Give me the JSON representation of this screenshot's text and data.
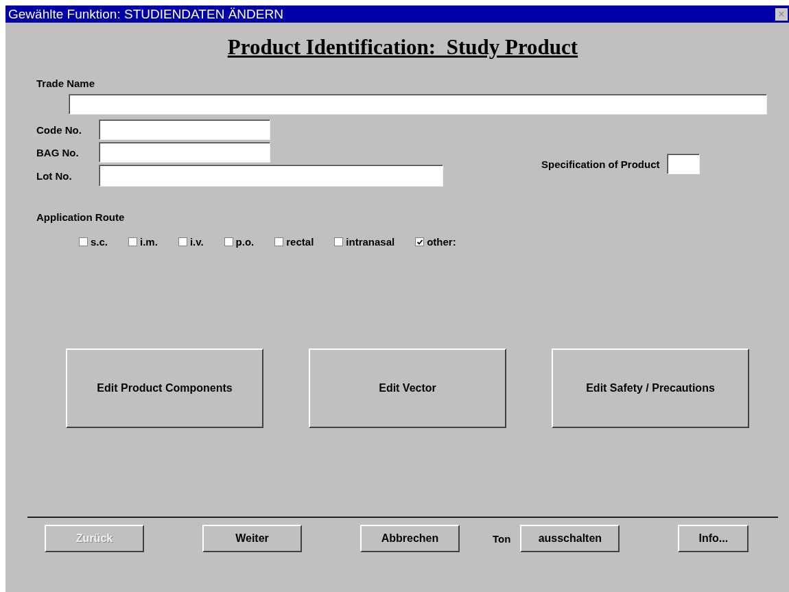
{
  "window": {
    "title": "Gewählte Funktion: STUDIENDATEN ÄNDERN",
    "close": "×"
  },
  "heading": "Product Identification:  Study Product",
  "trade_name": {
    "label": "Trade Name"
  },
  "fields": [
    {
      "label": "Code No."
    },
    {
      "label": "BAG No."
    },
    {
      "label": "Lot No."
    }
  ],
  "specification": {
    "label": "Specification of Product"
  },
  "application_route": {
    "label": "Application Route",
    "options": [
      {
        "label": "s.c.",
        "checked": false
      },
      {
        "label": "i.m.",
        "checked": false
      },
      {
        "label": "i.v.",
        "checked": false
      },
      {
        "label": "p.o.",
        "checked": false
      },
      {
        "label": "rectal",
        "checked": false
      },
      {
        "label": "intranasal",
        "checked": false
      },
      {
        "label": "other:",
        "checked": true
      }
    ]
  },
  "actions": [
    "Edit Product Components",
    "Edit Vector",
    "Edit Safety / Precautions"
  ],
  "footer": {
    "buttons": [
      {
        "label": "Zurück",
        "disabled": true
      },
      {
        "label": "Weiter",
        "disabled": false
      },
      {
        "label": "Abbrechen",
        "disabled": false
      }
    ],
    "sound_label": "Ton",
    "sound_button": "ausschalten",
    "info_button": "Info..."
  }
}
